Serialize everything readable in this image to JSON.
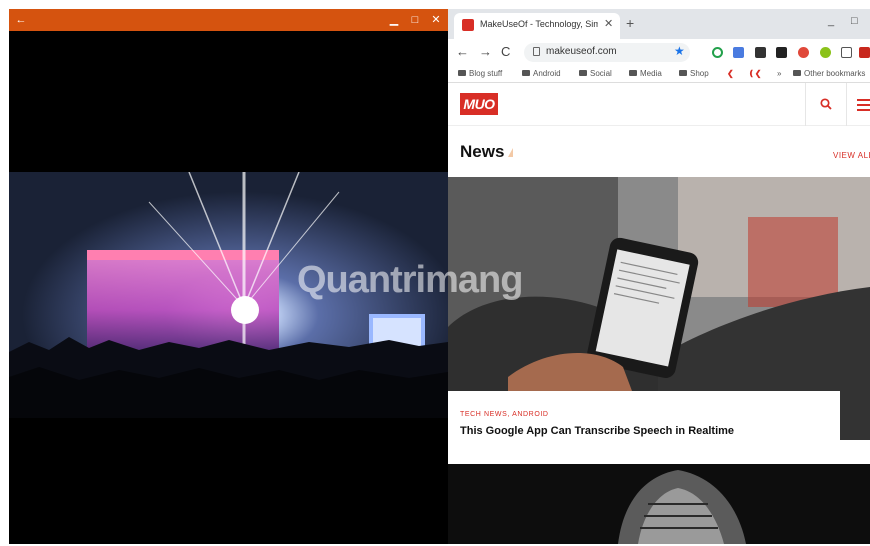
{
  "left_window": {
    "back_icon": "←",
    "minimize_icon": "▁",
    "maximize_icon": "□",
    "close_icon": "✕",
    "accent": "#d5530f"
  },
  "browser": {
    "tab_title": "MakeUseOf - Technology, Simplified",
    "tab_close": "✕",
    "new_tab": "+",
    "window_min": "_",
    "window_max": "□",
    "url": "makeuseof.com",
    "back": "←",
    "forward": "→",
    "reload": "C",
    "star": "★",
    "bookmarks": [
      {
        "label": "Blog stuff"
      },
      {
        "label": "Android"
      },
      {
        "label": "Social"
      },
      {
        "label": "Media"
      },
      {
        "label": "Shop"
      },
      {
        "label": "»"
      },
      {
        "label": "Other bookmarks"
      }
    ]
  },
  "site": {
    "logo": "MUO",
    "section_title": "News",
    "view_all": "VIEW ALL",
    "article": {
      "categories": "TECH NEWS,  ANDROID",
      "title": "This Google App Can Transcribe Speech in Realtime"
    },
    "brand_color": "#d82e26"
  },
  "watermark": "Quantrimang"
}
